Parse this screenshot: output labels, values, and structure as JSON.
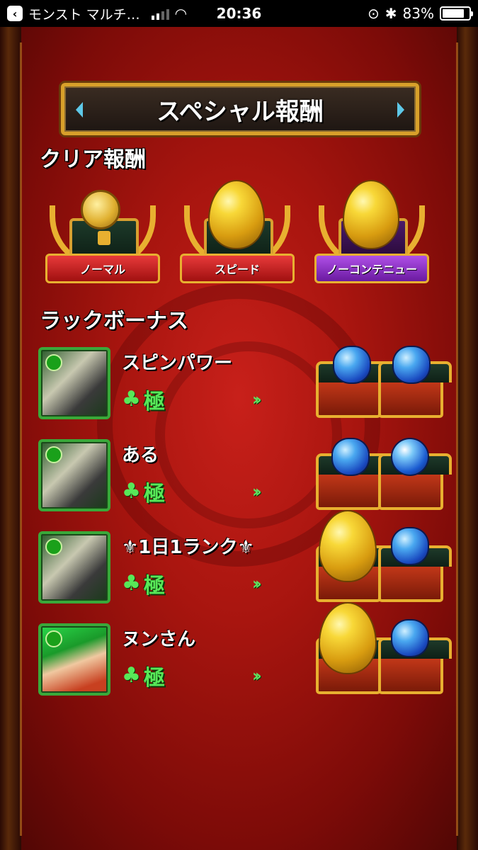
{
  "status_bar": {
    "app_name": "モンスト マルチ…",
    "time": "20:36",
    "battery_percent": "83%",
    "battery_level": 0.83
  },
  "title": "スペシャル報酬",
  "clear_rewards": {
    "heading": "クリア報酬",
    "items": [
      {
        "label": "ノーマル",
        "reward_icon": "gold-coin-icon",
        "ribbon_color": "#c8201a"
      },
      {
        "label": "スピード",
        "reward_icon": "golden-egg-icon",
        "ribbon_color": "#c8201a"
      },
      {
        "label": "ノーコンテニュー",
        "reward_icon": "golden-egg-icon",
        "ribbon_color": "#8a2ad0"
      }
    ]
  },
  "luck_bonus": {
    "heading": "ラックボーナス",
    "rows": [
      {
        "name": "スピンパワー",
        "luck": "極",
        "rewards": [
          "blue-gem-icon",
          "blue-gem-icon"
        ]
      },
      {
        "name": "ある",
        "luck": "極",
        "rewards": [
          "blue-gem-icon",
          "blue-orb-icon"
        ]
      },
      {
        "name": "⚜1日1ランク⚜",
        "luck": "極",
        "rewards": [
          "golden-egg-icon",
          "blue-gem-icon"
        ]
      },
      {
        "name": "ヌンさん",
        "luck": "極",
        "rewards": [
          "golden-egg-icon",
          "blue-gem-icon"
        ]
      }
    ]
  },
  "colors": {
    "background": "#a8150f",
    "gold": "#e8b030",
    "luck_green": "#58e858"
  }
}
